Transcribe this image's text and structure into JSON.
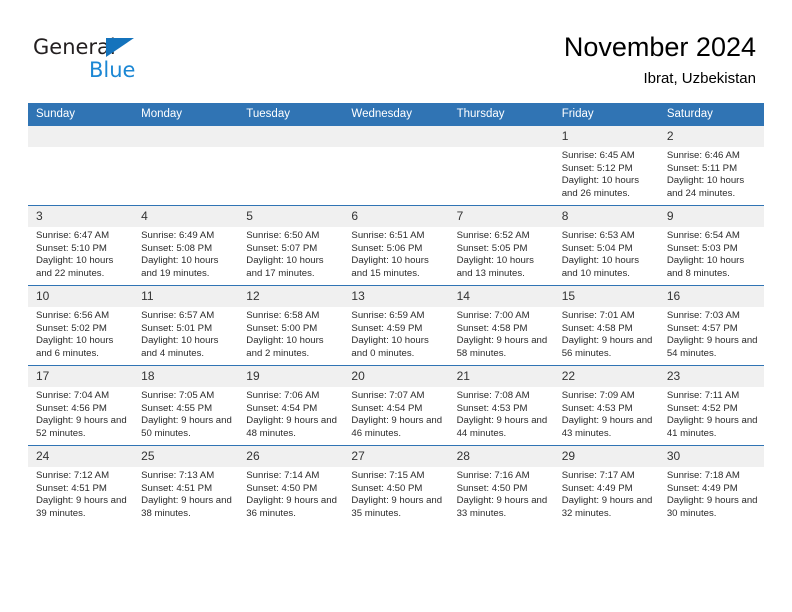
{
  "logo": {
    "word_one": "General",
    "word_two": "Blue",
    "triangle_color": "#1473bc",
    "blue_color": "#1b87d4"
  },
  "header": {
    "title": "November 2024",
    "subtitle": "Ibrat, Uzbekistan"
  },
  "theme": {
    "header_blue": "#3074b4",
    "daynum_bg": "#f0f0f0"
  },
  "calendar": {
    "weekday_headers": [
      "Sunday",
      "Monday",
      "Tuesday",
      "Wednesday",
      "Thursday",
      "Friday",
      "Saturday"
    ],
    "labels": {
      "sunrise": "Sunrise:",
      "sunset": "Sunset:",
      "daylight": "Daylight:"
    },
    "weeks": [
      [
        {
          "day": "",
          "sunrise": "",
          "sunset": "",
          "daylight": ""
        },
        {
          "day": "",
          "sunrise": "",
          "sunset": "",
          "daylight": ""
        },
        {
          "day": "",
          "sunrise": "",
          "sunset": "",
          "daylight": ""
        },
        {
          "day": "",
          "sunrise": "",
          "sunset": "",
          "daylight": ""
        },
        {
          "day": "",
          "sunrise": "",
          "sunset": "",
          "daylight": ""
        },
        {
          "day": "1",
          "sunrise": "Sunrise: 6:45 AM",
          "sunset": "Sunset: 5:12 PM",
          "daylight": "Daylight: 10 hours and 26 minutes."
        },
        {
          "day": "2",
          "sunrise": "Sunrise: 6:46 AM",
          "sunset": "Sunset: 5:11 PM",
          "daylight": "Daylight: 10 hours and 24 minutes."
        }
      ],
      [
        {
          "day": "3",
          "sunrise": "Sunrise: 6:47 AM",
          "sunset": "Sunset: 5:10 PM",
          "daylight": "Daylight: 10 hours and 22 minutes."
        },
        {
          "day": "4",
          "sunrise": "Sunrise: 6:49 AM",
          "sunset": "Sunset: 5:08 PM",
          "daylight": "Daylight: 10 hours and 19 minutes."
        },
        {
          "day": "5",
          "sunrise": "Sunrise: 6:50 AM",
          "sunset": "Sunset: 5:07 PM",
          "daylight": "Daylight: 10 hours and 17 minutes."
        },
        {
          "day": "6",
          "sunrise": "Sunrise: 6:51 AM",
          "sunset": "Sunset: 5:06 PM",
          "daylight": "Daylight: 10 hours and 15 minutes."
        },
        {
          "day": "7",
          "sunrise": "Sunrise: 6:52 AM",
          "sunset": "Sunset: 5:05 PM",
          "daylight": "Daylight: 10 hours and 13 minutes."
        },
        {
          "day": "8",
          "sunrise": "Sunrise: 6:53 AM",
          "sunset": "Sunset: 5:04 PM",
          "daylight": "Daylight: 10 hours and 10 minutes."
        },
        {
          "day": "9",
          "sunrise": "Sunrise: 6:54 AM",
          "sunset": "Sunset: 5:03 PM",
          "daylight": "Daylight: 10 hours and 8 minutes."
        }
      ],
      [
        {
          "day": "10",
          "sunrise": "Sunrise: 6:56 AM",
          "sunset": "Sunset: 5:02 PM",
          "daylight": "Daylight: 10 hours and 6 minutes."
        },
        {
          "day": "11",
          "sunrise": "Sunrise: 6:57 AM",
          "sunset": "Sunset: 5:01 PM",
          "daylight": "Daylight: 10 hours and 4 minutes."
        },
        {
          "day": "12",
          "sunrise": "Sunrise: 6:58 AM",
          "sunset": "Sunset: 5:00 PM",
          "daylight": "Daylight: 10 hours and 2 minutes."
        },
        {
          "day": "13",
          "sunrise": "Sunrise: 6:59 AM",
          "sunset": "Sunset: 4:59 PM",
          "daylight": "Daylight: 10 hours and 0 minutes."
        },
        {
          "day": "14",
          "sunrise": "Sunrise: 7:00 AM",
          "sunset": "Sunset: 4:58 PM",
          "daylight": "Daylight: 9 hours and 58 minutes."
        },
        {
          "day": "15",
          "sunrise": "Sunrise: 7:01 AM",
          "sunset": "Sunset: 4:58 PM",
          "daylight": "Daylight: 9 hours and 56 minutes."
        },
        {
          "day": "16",
          "sunrise": "Sunrise: 7:03 AM",
          "sunset": "Sunset: 4:57 PM",
          "daylight": "Daylight: 9 hours and 54 minutes."
        }
      ],
      [
        {
          "day": "17",
          "sunrise": "Sunrise: 7:04 AM",
          "sunset": "Sunset: 4:56 PM",
          "daylight": "Daylight: 9 hours and 52 minutes."
        },
        {
          "day": "18",
          "sunrise": "Sunrise: 7:05 AM",
          "sunset": "Sunset: 4:55 PM",
          "daylight": "Daylight: 9 hours and 50 minutes."
        },
        {
          "day": "19",
          "sunrise": "Sunrise: 7:06 AM",
          "sunset": "Sunset: 4:54 PM",
          "daylight": "Daylight: 9 hours and 48 minutes."
        },
        {
          "day": "20",
          "sunrise": "Sunrise: 7:07 AM",
          "sunset": "Sunset: 4:54 PM",
          "daylight": "Daylight: 9 hours and 46 minutes."
        },
        {
          "day": "21",
          "sunrise": "Sunrise: 7:08 AM",
          "sunset": "Sunset: 4:53 PM",
          "daylight": "Daylight: 9 hours and 44 minutes."
        },
        {
          "day": "22",
          "sunrise": "Sunrise: 7:09 AM",
          "sunset": "Sunset: 4:53 PM",
          "daylight": "Daylight: 9 hours and 43 minutes."
        },
        {
          "day": "23",
          "sunrise": "Sunrise: 7:11 AM",
          "sunset": "Sunset: 4:52 PM",
          "daylight": "Daylight: 9 hours and 41 minutes."
        }
      ],
      [
        {
          "day": "24",
          "sunrise": "Sunrise: 7:12 AM",
          "sunset": "Sunset: 4:51 PM",
          "daylight": "Daylight: 9 hours and 39 minutes."
        },
        {
          "day": "25",
          "sunrise": "Sunrise: 7:13 AM",
          "sunset": "Sunset: 4:51 PM",
          "daylight": "Daylight: 9 hours and 38 minutes."
        },
        {
          "day": "26",
          "sunrise": "Sunrise: 7:14 AM",
          "sunset": "Sunset: 4:50 PM",
          "daylight": "Daylight: 9 hours and 36 minutes."
        },
        {
          "day": "27",
          "sunrise": "Sunrise: 7:15 AM",
          "sunset": "Sunset: 4:50 PM",
          "daylight": "Daylight: 9 hours and 35 minutes."
        },
        {
          "day": "28",
          "sunrise": "Sunrise: 7:16 AM",
          "sunset": "Sunset: 4:50 PM",
          "daylight": "Daylight: 9 hours and 33 minutes."
        },
        {
          "day": "29",
          "sunrise": "Sunrise: 7:17 AM",
          "sunset": "Sunset: 4:49 PM",
          "daylight": "Daylight: 9 hours and 32 minutes."
        },
        {
          "day": "30",
          "sunrise": "Sunrise: 7:18 AM",
          "sunset": "Sunset: 4:49 PM",
          "daylight": "Daylight: 9 hours and 30 minutes."
        }
      ]
    ]
  }
}
